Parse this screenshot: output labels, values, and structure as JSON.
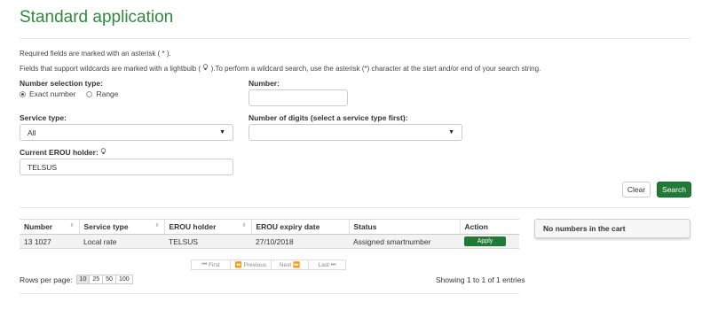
{
  "page": {
    "title": "Standard application"
  },
  "notes": {
    "required": "Required fields are marked with an asterisk ( * ).",
    "wildcard_pre": "Fields that support wildcards are marked with a lightbulb (",
    "wildcard_post": ").To perform a wildcard search, use the asterisk (*) character at the start and/or end of your search string."
  },
  "form": {
    "number_selection_label": "Number selection type:",
    "options": {
      "exact": "Exact number",
      "range": "Range"
    },
    "number_label": "Number:",
    "number_value": "",
    "service_type_label": "Service type:",
    "service_type_value": "All",
    "digits_label": "Number of digits (select a service type first):",
    "digits_value": "",
    "holder_label": "Current EROU holder:",
    "holder_value": "TELSUS"
  },
  "buttons": {
    "clear": "Clear",
    "search": "Search"
  },
  "table": {
    "headers": [
      "Number",
      "Service type",
      "EROU holder",
      "EROU expiry date",
      "Status",
      "Action"
    ],
    "rows": [
      {
        "number": "13 1027",
        "service_type": "Local rate",
        "holder": "TELSUS",
        "expiry": "27/10/2018",
        "status": "Assigned smartnumber",
        "action": "Apply"
      }
    ]
  },
  "cart": {
    "text": "No numbers in the cart"
  },
  "pagination": {
    "first": "First",
    "previous": "Previous",
    "next": "Next",
    "last": "Last"
  },
  "rows_per_page": {
    "label": "Rows per page:",
    "options": [
      "10",
      "25",
      "50",
      "100"
    ],
    "selected": "10"
  },
  "summary": "Showing 1 to 1 of 1 entries"
}
